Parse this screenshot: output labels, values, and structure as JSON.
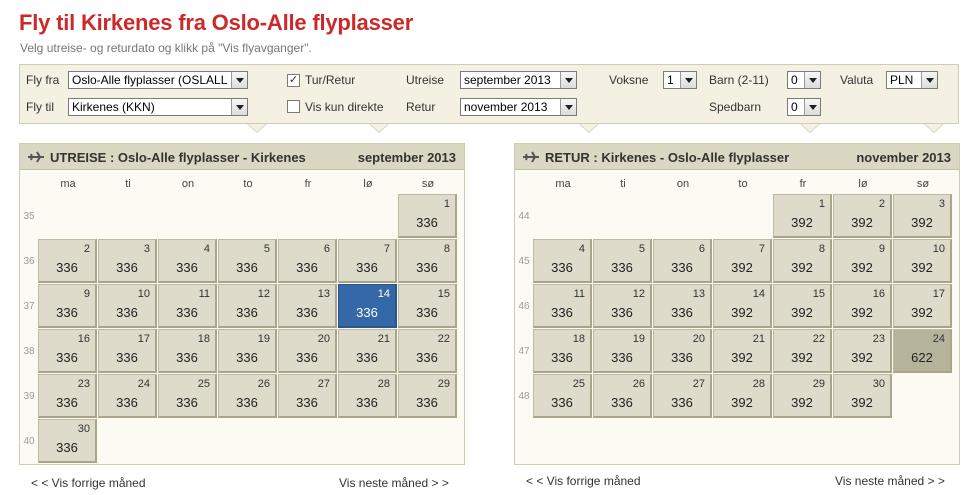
{
  "header": {
    "title": "Fly til Kirkenes fra Oslo-Alle flyplasser",
    "subtitle": "Velg utreise- og returdato og klikk på \"Vis flyavganger\"."
  },
  "filters": {
    "from_label": "Fly fra",
    "from_value": "Oslo-Alle flyplasser (OSLALL",
    "to_label": "Fly til",
    "to_value": "Kirkenes (KKN)",
    "roundtrip_label": "Tur/Retur",
    "roundtrip_checked": true,
    "direct_label": "Vis kun direkte",
    "direct_checked": false,
    "outbound_label": "Utreise",
    "outbound_value": "september 2013",
    "return_label": "Retur",
    "return_value": "november 2013",
    "adults_label": "Voksne",
    "adults_value": "1",
    "children_label": "Barn (2-11)",
    "children_value": "0",
    "infants_label": "Spedbarn",
    "infants_value": "0",
    "currency_label": "Valuta",
    "currency_value": "PLN"
  },
  "outbound": {
    "direction": "UTREISE :",
    "route": "Oslo-Alle flyplasser - Kirkenes",
    "month": "september 2013",
    "weekdays": [
      "ma",
      "ti",
      "on",
      "to",
      "fr",
      "lø",
      "sø"
    ],
    "weeks": [
      "35",
      "36",
      "37",
      "38",
      "39",
      "40"
    ],
    "days": [
      {
        "d": "1",
        "p": "336"
      },
      {
        "d": "2",
        "p": "336"
      },
      {
        "d": "3",
        "p": "336"
      },
      {
        "d": "4",
        "p": "336"
      },
      {
        "d": "5",
        "p": "336"
      },
      {
        "d": "6",
        "p": "336"
      },
      {
        "d": "7",
        "p": "336"
      },
      {
        "d": "8",
        "p": "336"
      },
      {
        "d": "9",
        "p": "336"
      },
      {
        "d": "10",
        "p": "336"
      },
      {
        "d": "11",
        "p": "336"
      },
      {
        "d": "12",
        "p": "336"
      },
      {
        "d": "13",
        "p": "336"
      },
      {
        "d": "14",
        "p": "336"
      },
      {
        "d": "15",
        "p": "336"
      },
      {
        "d": "16",
        "p": "336"
      },
      {
        "d": "17",
        "p": "336"
      },
      {
        "d": "18",
        "p": "336"
      },
      {
        "d": "19",
        "p": "336"
      },
      {
        "d": "20",
        "p": "336"
      },
      {
        "d": "21",
        "p": "336"
      },
      {
        "d": "22",
        "p": "336"
      },
      {
        "d": "23",
        "p": "336"
      },
      {
        "d": "24",
        "p": "336"
      },
      {
        "d": "25",
        "p": "336"
      },
      {
        "d": "26",
        "p": "336"
      },
      {
        "d": "27",
        "p": "336"
      },
      {
        "d": "28",
        "p": "336"
      },
      {
        "d": "29",
        "p": "336"
      },
      {
        "d": "30",
        "p": "336"
      }
    ],
    "selected_day": "14",
    "prev_link": "< < Vis forrige måned",
    "next_link": "Vis neste måned > >"
  },
  "return": {
    "direction": "RETUR :",
    "route": "Kirkenes - Oslo-Alle flyplasser",
    "month": "november 2013",
    "weekdays": [
      "ma",
      "ti",
      "on",
      "to",
      "fr",
      "lø",
      "sø"
    ],
    "weeks": [
      "44",
      "45",
      "46",
      "47",
      "48"
    ],
    "days": [
      {
        "d": "1",
        "p": "392"
      },
      {
        "d": "2",
        "p": "392"
      },
      {
        "d": "3",
        "p": "392"
      },
      {
        "d": "4",
        "p": "336"
      },
      {
        "d": "5",
        "p": "336"
      },
      {
        "d": "6",
        "p": "336"
      },
      {
        "d": "7",
        "p": "392"
      },
      {
        "d": "8",
        "p": "392"
      },
      {
        "d": "9",
        "p": "392"
      },
      {
        "d": "10",
        "p": "392"
      },
      {
        "d": "11",
        "p": "336"
      },
      {
        "d": "12",
        "p": "336"
      },
      {
        "d": "13",
        "p": "336"
      },
      {
        "d": "14",
        "p": "392"
      },
      {
        "d": "15",
        "p": "392"
      },
      {
        "d": "16",
        "p": "392"
      },
      {
        "d": "17",
        "p": "392"
      },
      {
        "d": "18",
        "p": "336"
      },
      {
        "d": "19",
        "p": "336"
      },
      {
        "d": "20",
        "p": "336"
      },
      {
        "d": "21",
        "p": "392"
      },
      {
        "d": "22",
        "p": "392"
      },
      {
        "d": "23",
        "p": "392"
      },
      {
        "d": "24",
        "p": "622"
      },
      {
        "d": "25",
        "p": "336"
      },
      {
        "d": "26",
        "p": "336"
      },
      {
        "d": "27",
        "p": "336"
      },
      {
        "d": "28",
        "p": "392"
      },
      {
        "d": "29",
        "p": "392"
      },
      {
        "d": "30",
        "p": "392"
      }
    ],
    "highlight_day": "24",
    "prev_link": "< < Vis forrige måned",
    "next_link": "Vis neste måned > >"
  },
  "colors": {
    "title": "#cc2a2a",
    "selected": "#3468a6",
    "panel_head": "#dad7c2",
    "day_bg": "#dedbca"
  },
  "icons": {
    "plane": "plane-icon",
    "dropdown": "chevron-down-icon"
  }
}
